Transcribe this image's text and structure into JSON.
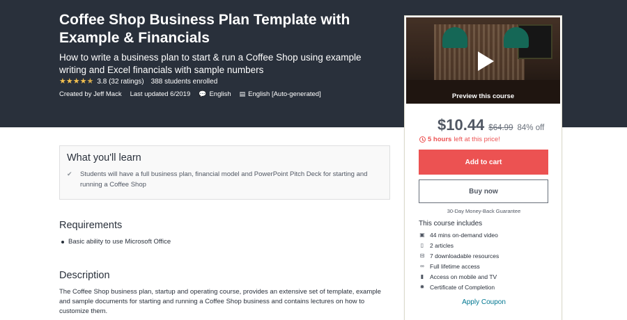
{
  "hero": {
    "title": "Coffee Shop Business Plan Template with Example & Financials",
    "subtitle": "How to write a business plan to start & run a Coffee Shop using example writing and Excel financials with sample numbers",
    "rating": "3.8",
    "ratings_count": "(32 ratings)",
    "enrolled": "388 students enrolled",
    "created_by": "Created by Jeff Mack",
    "last_updated": "Last updated 6/2019",
    "language": "English",
    "captions": "English [Auto-generated]",
    "star_color": "#f4c150",
    "background": "#29303b"
  },
  "sidebar": {
    "preview_label": "Preview this course",
    "price": "$10.44",
    "original_price": "$64.99",
    "discount": "84% off",
    "timer_bold": "5 hours",
    "timer_rest": "left at this price!",
    "add_to_cart": "Add to cart",
    "buy_now": "Buy now",
    "guarantee": "30-Day Money-Back Guarantee",
    "includes_title": "This course includes",
    "includes": [
      {
        "icon": "video-icon",
        "label": "44 mins on-demand video"
      },
      {
        "icon": "file-icon",
        "label": "2 articles"
      },
      {
        "icon": "download-icon",
        "label": "7 downloadable resources"
      },
      {
        "icon": "infinity-icon",
        "label": "Full lifetime access"
      },
      {
        "icon": "mobile-icon",
        "label": "Access on mobile and TV"
      },
      {
        "icon": "certificate-icon",
        "label": "Certificate of Completion"
      }
    ],
    "apply_coupon": "Apply Coupon",
    "accent_color": "#ec5252",
    "link_color": "#007791"
  },
  "learn": {
    "title": "What you'll learn",
    "items": [
      "Students will have a full business plan, financial model and PowerPoint Pitch Deck for starting and running a Coffee Shop"
    ]
  },
  "requirements": {
    "title": "Requirements",
    "items": [
      "Basic ability to use Microsoft Office"
    ]
  },
  "description": {
    "title": "Description",
    "text": "The Coffee Shop business plan, startup and operating course, provides an extensive set of template, example and sample documents for starting and running a Coffee Shop business and contains lectures on how to customize them."
  }
}
